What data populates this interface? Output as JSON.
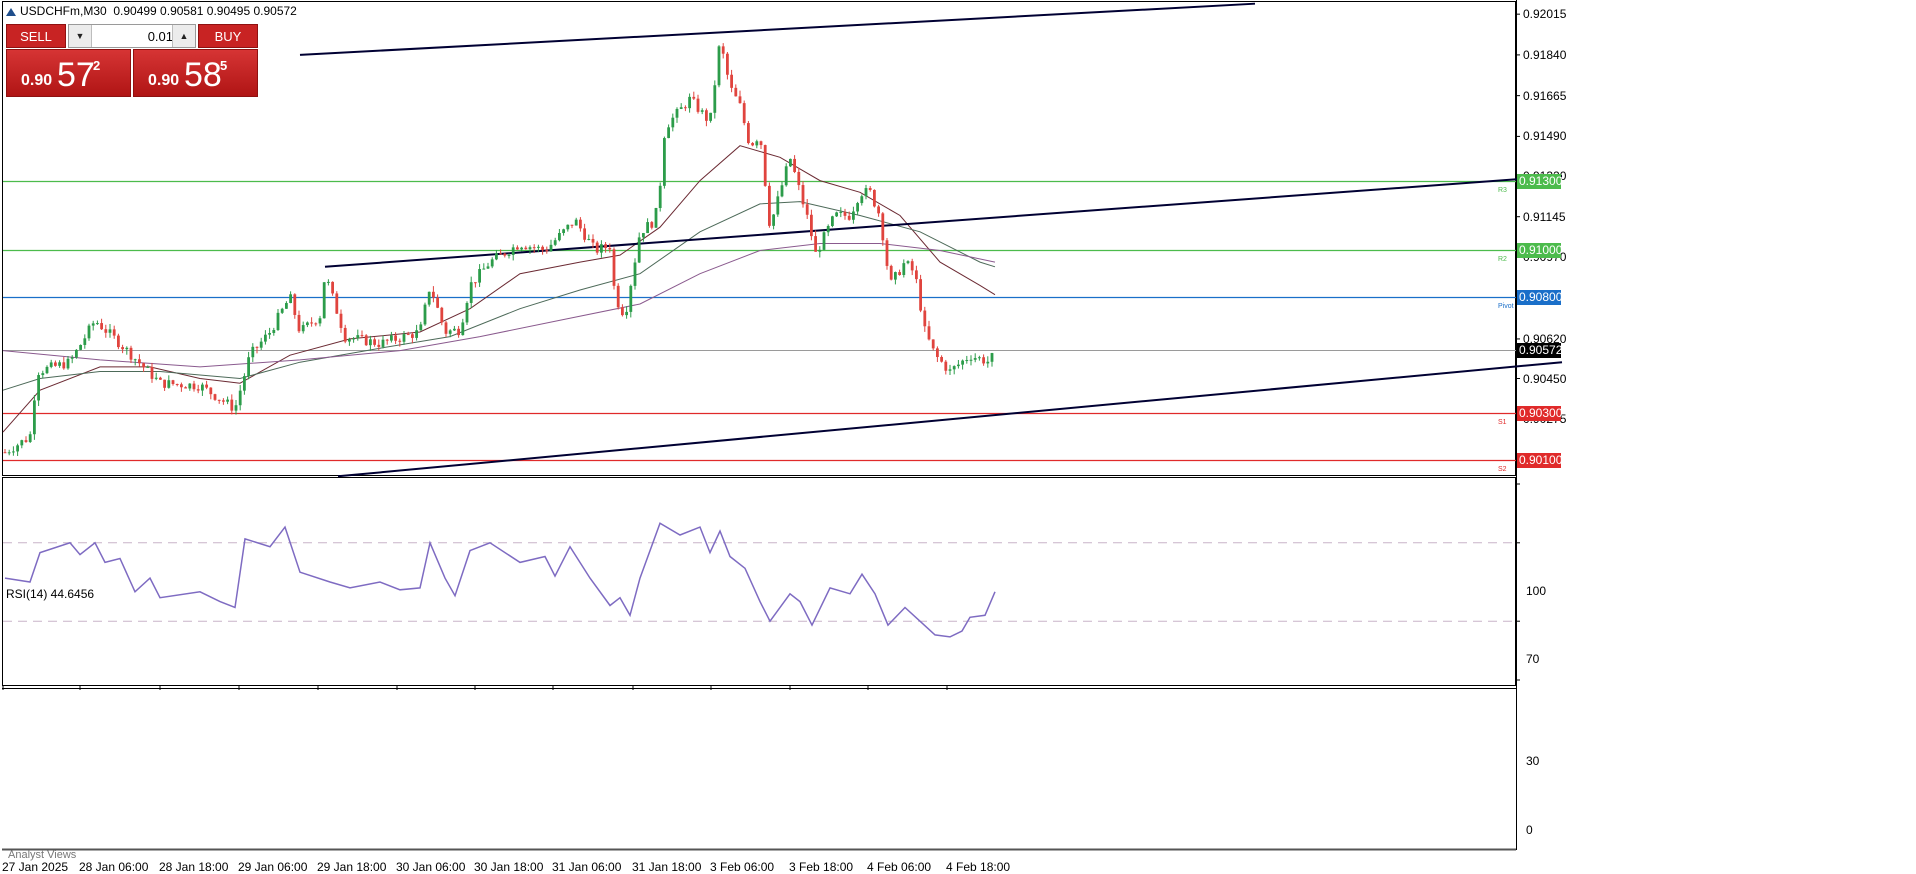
{
  "header": {
    "symbol": "USDCHFm,M30",
    "ohlc": "0.90499 0.90581 0.90495 0.90572"
  },
  "trade_panel": {
    "sell_label": "SELL",
    "buy_label": "BUY",
    "lot_value": "0.01",
    "sell_small": "0.90",
    "sell_big": "57",
    "sell_sup": "2",
    "buy_small": "0.90",
    "buy_big": "58",
    "buy_sup": "5",
    "lot_down_icon": "triangle-down-icon",
    "lot_up_icon": "triangle-up-icon"
  },
  "price_axis_ticks": [
    "0.92015",
    "0.91840",
    "0.91665",
    "0.91490",
    "0.91320",
    "0.91145",
    "0.90970",
    "0.90620",
    "0.90450",
    "0.90275"
  ],
  "price_levels": [
    {
      "label": "0.91300",
      "value": 0.913,
      "color": "#4cbb4c",
      "tag": "R3"
    },
    {
      "label": "0.91000",
      "value": 0.91,
      "color": "#4cbb4c",
      "tag": "R2"
    },
    {
      "label": "0.90800",
      "value": 0.908,
      "color": "#1a6fc9",
      "tag": "Pivot"
    },
    {
      "label": "0.90300",
      "value": 0.903,
      "color": "#e02a2a",
      "tag": "S1"
    },
    {
      "label": "0.90100",
      "value": 0.901,
      "color": "#e02a2a",
      "tag": "S2"
    }
  ],
  "current_price": {
    "label": "0.90572",
    "value": 0.90572,
    "color": "#000000"
  },
  "time_axis": [
    "27 Jan 2025",
    "28 Jan 06:00",
    "28 Jan 18:00",
    "29 Jan 06:00",
    "29 Jan 18:00",
    "30 Jan 06:00",
    "30 Jan 18:00",
    "31 Jan 06:00",
    "31 Jan 18:00",
    "3 Feb 06:00",
    "3 Feb 18:00",
    "4 Feb 06:00",
    "4 Feb 18:00"
  ],
  "rsi": {
    "title": "RSI(14) 44.6456",
    "levels": [
      "100",
      "70",
      "30",
      "0"
    ]
  },
  "analyst_label": "Analyst Views",
  "chart_data": {
    "type": "candlestick",
    "symbol": "USDCHFm",
    "timeframe": "M30",
    "ylim": [
      0.901,
      0.9205
    ],
    "grid": false,
    "price_path": [
      [
        0,
        0.9012
      ],
      [
        30,
        0.902
      ],
      [
        37,
        0.9048
      ],
      [
        70,
        0.9052
      ],
      [
        95,
        0.907
      ],
      [
        120,
        0.906
      ],
      [
        160,
        0.9043
      ],
      [
        200,
        0.9042
      ],
      [
        235,
        0.9032
      ],
      [
        250,
        0.9055
      ],
      [
        270,
        0.9065
      ],
      [
        290,
        0.908
      ],
      [
        300,
        0.9065
      ],
      [
        320,
        0.9072
      ],
      [
        325,
        0.909
      ],
      [
        345,
        0.9063
      ],
      [
        380,
        0.906
      ],
      [
        420,
        0.9065
      ],
      [
        430,
        0.9085
      ],
      [
        445,
        0.9065
      ],
      [
        460,
        0.9066
      ],
      [
        470,
        0.9085
      ],
      [
        490,
        0.9095
      ],
      [
        520,
        0.9103
      ],
      [
        545,
        0.91
      ],
      [
        575,
        0.9113
      ],
      [
        595,
        0.91
      ],
      [
        610,
        0.9102
      ],
      [
        615,
        0.908
      ],
      [
        625,
        0.9072
      ],
      [
        640,
        0.9108
      ],
      [
        655,
        0.9113
      ],
      [
        660,
        0.9128
      ],
      [
        665,
        0.9153
      ],
      [
        690,
        0.9165
      ],
      [
        710,
        0.9155
      ],
      [
        720,
        0.919
      ],
      [
        730,
        0.917
      ],
      [
        740,
        0.9162
      ],
      [
        750,
        0.9145
      ],
      [
        760,
        0.915
      ],
      [
        770,
        0.911
      ],
      [
        790,
        0.914
      ],
      [
        810,
        0.911
      ],
      [
        815,
        0.9098
      ],
      [
        835,
        0.9115
      ],
      [
        850,
        0.9115
      ],
      [
        860,
        0.9125
      ],
      [
        870,
        0.9125
      ],
      [
        880,
        0.9115
      ],
      [
        890,
        0.9085
      ],
      [
        905,
        0.9095
      ],
      [
        915,
        0.909
      ],
      [
        925,
        0.9065
      ],
      [
        935,
        0.9055
      ],
      [
        950,
        0.9048
      ],
      [
        970,
        0.9055
      ],
      [
        990,
        0.9052
      ],
      [
        995,
        0.9057
      ]
    ],
    "ma_fast": [
      [
        3,
        0.9022
      ],
      [
        40,
        0.904
      ],
      [
        100,
        0.905
      ],
      [
        150,
        0.905
      ],
      [
        200,
        0.9045
      ],
      [
        240,
        0.9043
      ],
      [
        290,
        0.9055
      ],
      [
        350,
        0.9062
      ],
      [
        420,
        0.9065
      ],
      [
        470,
        0.9075
      ],
      [
        520,
        0.909
      ],
      [
        580,
        0.9095
      ],
      [
        620,
        0.9098
      ],
      [
        660,
        0.911
      ],
      [
        700,
        0.913
      ],
      [
        740,
        0.9145
      ],
      [
        780,
        0.914
      ],
      [
        820,
        0.913
      ],
      [
        860,
        0.9125
      ],
      [
        900,
        0.9115
      ],
      [
        940,
        0.9095
      ],
      [
        980,
        0.9085
      ],
      [
        995,
        0.9081
      ]
    ],
    "ma_mid": [
      [
        3,
        0.904
      ],
      [
        40,
        0.9045
      ],
      [
        100,
        0.9048
      ],
      [
        160,
        0.9048
      ],
      [
        240,
        0.9045
      ],
      [
        300,
        0.9052
      ],
      [
        380,
        0.9058
      ],
      [
        450,
        0.9063
      ],
      [
        520,
        0.9075
      ],
      [
        580,
        0.9083
      ],
      [
        640,
        0.909
      ],
      [
        700,
        0.9108
      ],
      [
        760,
        0.912
      ],
      [
        800,
        0.9121
      ],
      [
        860,
        0.9115
      ],
      [
        920,
        0.9108
      ],
      [
        980,
        0.9095
      ],
      [
        995,
        0.9093
      ]
    ],
    "ma_slow": [
      [
        3,
        0.9057
      ],
      [
        100,
        0.9053
      ],
      [
        200,
        0.905
      ],
      [
        300,
        0.9053
      ],
      [
        400,
        0.9057
      ],
      [
        480,
        0.9063
      ],
      [
        560,
        0.907
      ],
      [
        640,
        0.9077
      ],
      [
        700,
        0.909
      ],
      [
        760,
        0.91
      ],
      [
        820,
        0.9103
      ],
      [
        880,
        0.9103
      ],
      [
        940,
        0.91
      ],
      [
        995,
        0.9095
      ]
    ],
    "trendlines": [
      [
        [
          300,
          0.9184
        ],
        [
          1255,
          0.9206
        ]
      ],
      [
        [
          325,
          0.9093
        ],
        [
          1562,
          0.9132
        ]
      ],
      [
        [
          338,
          0.9003
        ],
        [
          1562,
          0.9052
        ]
      ]
    ],
    "rsi_path": [
      [
        5,
        52
      ],
      [
        30,
        50
      ],
      [
        40,
        65
      ],
      [
        70,
        70
      ],
      [
        80,
        64
      ],
      [
        95,
        70
      ],
      [
        105,
        60
      ],
      [
        120,
        62
      ],
      [
        135,
        45
      ],
      [
        150,
        52
      ],
      [
        160,
        42
      ],
      [
        200,
        45
      ],
      [
        220,
        40
      ],
      [
        235,
        37
      ],
      [
        245,
        72
      ],
      [
        270,
        68
      ],
      [
        285,
        78
      ],
      [
        300,
        55
      ],
      [
        330,
        50
      ],
      [
        350,
        47
      ],
      [
        380,
        50
      ],
      [
        400,
        46
      ],
      [
        420,
        47
      ],
      [
        430,
        70
      ],
      [
        445,
        52
      ],
      [
        455,
        43
      ],
      [
        470,
        66
      ],
      [
        490,
        70
      ],
      [
        520,
        60
      ],
      [
        545,
        63
      ],
      [
        555,
        53
      ],
      [
        570,
        68
      ],
      [
        590,
        52
      ],
      [
        610,
        38
      ],
      [
        620,
        42
      ],
      [
        630,
        33
      ],
      [
        640,
        52
      ],
      [
        660,
        80
      ],
      [
        680,
        74
      ],
      [
        700,
        78
      ],
      [
        710,
        65
      ],
      [
        720,
        76
      ],
      [
        730,
        63
      ],
      [
        745,
        57
      ],
      [
        760,
        40
      ],
      [
        770,
        30
      ],
      [
        790,
        44
      ],
      [
        800,
        40
      ],
      [
        812,
        28
      ],
      [
        830,
        47
      ],
      [
        850,
        44
      ],
      [
        862,
        54
      ],
      [
        875,
        44
      ],
      [
        888,
        28
      ],
      [
        905,
        37
      ],
      [
        920,
        30
      ],
      [
        935,
        23
      ],
      [
        950,
        22
      ],
      [
        962,
        25
      ],
      [
        970,
        32
      ],
      [
        985,
        33
      ],
      [
        995,
        45
      ]
    ],
    "rsi_levels": [
      70,
      30
    ]
  }
}
